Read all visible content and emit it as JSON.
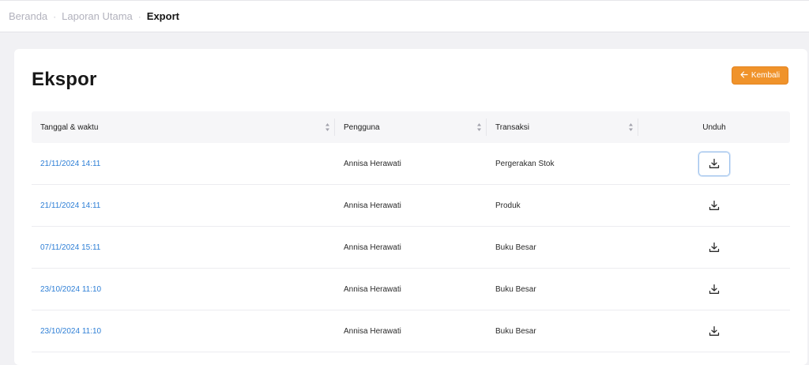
{
  "breadcrumb": {
    "items": [
      "Beranda",
      "Laporan Utama"
    ],
    "current": "Export",
    "separator": "·"
  },
  "page": {
    "title": "Ekspor",
    "back_label": "Kembali",
    "accent_color": "#f0932b"
  },
  "table": {
    "headers": [
      "Tanggal & waktu",
      "Pengguna",
      "Transaksi",
      "Unduh"
    ],
    "rows": [
      {
        "datetime": "21/11/2024 14:11",
        "user": "Annisa Herawati",
        "transaction": "Pergerakan Stok",
        "icon": "download-icon"
      },
      {
        "datetime": "21/11/2024 14:11",
        "user": "Annisa Herawati",
        "transaction": "Produk",
        "icon": "download-icon"
      },
      {
        "datetime": "07/11/2024 15:11",
        "user": "Annisa Herawati",
        "transaction": "Buku Besar",
        "icon": "download-icon"
      },
      {
        "datetime": "23/10/2024 11:10",
        "user": "Annisa Herawati",
        "transaction": "Buku Besar",
        "icon": "download-icon"
      },
      {
        "datetime": "23/10/2024 11:10",
        "user": "Annisa Herawati",
        "transaction": "Buku Besar",
        "icon": "download-icon"
      }
    ]
  }
}
